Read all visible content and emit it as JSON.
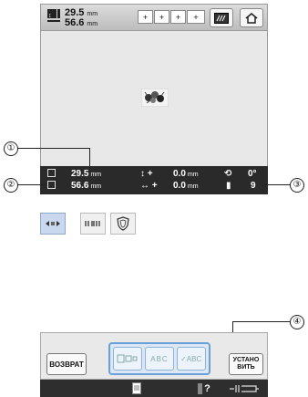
{
  "toolbar": {
    "height_value": "29.5",
    "width_value": "56.6",
    "unit": "mm",
    "hoop_labels": [
      "+",
      "+",
      "+",
      "+"
    ]
  },
  "info": {
    "height_value": "29.5",
    "width_value": "56.6",
    "unit": "mm",
    "vert_offset": "0.0",
    "horiz_offset": "0.0",
    "rotation": "0°",
    "colors": "9",
    "plus": "+"
  },
  "callouts": {
    "c1": "①",
    "c2": "②",
    "c3": "③",
    "c4": "④"
  },
  "bottom": {
    "return_label": "ВОЗВРАТ",
    "set_label_1": "УСТАНО",
    "set_label_2": "ВИТЬ",
    "opt2_label": "ABC",
    "opt3_label": "✓ABC"
  },
  "footer": {
    "question": "?"
  },
  "icons": {
    "size": "size-icon",
    "hoop": "hoop-icon",
    "fabric": "fabric-icon",
    "home": "home-icon",
    "thread": "thread-spool-icon",
    "rotate": "rotate-icon"
  },
  "colors": {
    "accent": "#6aa0d8",
    "infobar": "#2a2a2a",
    "mode_selected": "#c9d8ee"
  }
}
